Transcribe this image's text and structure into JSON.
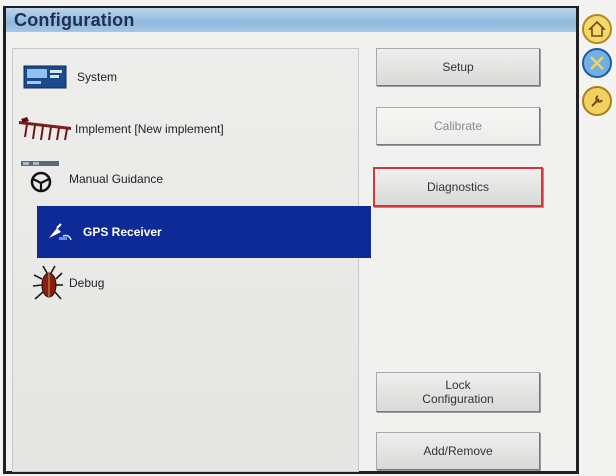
{
  "window": {
    "title": "Configuration"
  },
  "tree": {
    "items": [
      {
        "label": "System",
        "icon": "monitor-icon"
      },
      {
        "label": "Implement [New implement]",
        "icon": "implement-icon"
      },
      {
        "label": "Manual Guidance",
        "icon": "steering-wheel-icon"
      },
      {
        "label": "GPS Receiver",
        "icon": "gps-antenna-icon",
        "selected": true
      },
      {
        "label": "Debug",
        "icon": "bug-icon"
      }
    ]
  },
  "buttons": {
    "setup": "Setup",
    "calibrate": "Calibrate",
    "diagnostics": "Diagnostics",
    "lock_line1": "Lock",
    "lock_line2": "Configuration",
    "add_remove": "Add/Remove"
  },
  "side_toolbar": [
    {
      "icon": "home-icon"
    },
    {
      "icon": "tools-icon"
    },
    {
      "icon": "wrench-icon"
    }
  ],
  "colors": {
    "selection": "#0d2a96",
    "titlebar": "#9dc1e3",
    "highlight_border": "#d8343f",
    "side_icon": "#e8c23a"
  }
}
